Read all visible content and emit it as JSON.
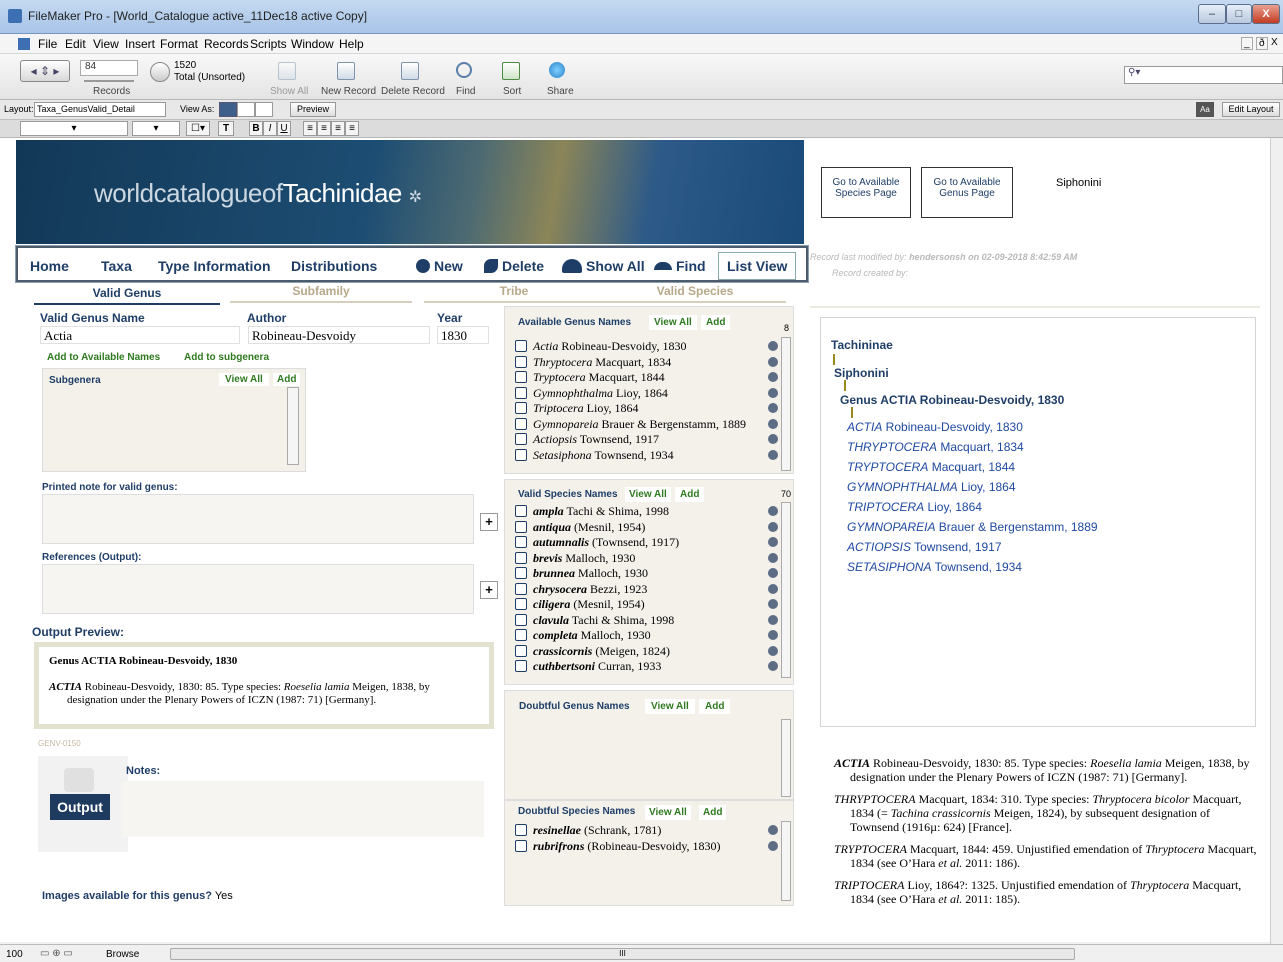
{
  "window": {
    "title": "FileMaker Pro - [World_Catalogue active_11Dec18 active Copy]",
    "controls": [
      "–",
      "□",
      "X"
    ]
  },
  "menubar": {
    "items": [
      "File",
      "Edit",
      "View",
      "Insert",
      "Format",
      "Records",
      "Scripts",
      "Window",
      "Help"
    ],
    "right_controls": [
      "_",
      "ð",
      "X"
    ]
  },
  "toolbar": {
    "record_number": "84",
    "records_label": "Records",
    "total": "1520",
    "total_label": "Total (Unsorted)",
    "buttons": [
      "Show All",
      "New Record",
      "Delete Record",
      "Find",
      "Sort",
      "Share"
    ]
  },
  "layoutbar": {
    "layout_label": "Layout:",
    "layout_value": "Taxa_GenusValid_Detail",
    "viewas_label": "View As:",
    "preview": "Preview",
    "edit_layout": "Edit Layout",
    "aa": "Aa"
  },
  "banner": {
    "logo_light": "worldcatalogueof",
    "logo_bold": "Tachinidae"
  },
  "nav": {
    "items": [
      "Home",
      "Taxa",
      "Type Information",
      "Distributions"
    ],
    "new": "New",
    "delete": "Delete",
    "show_all": "Show All",
    "find": "Find",
    "list_view": "List View"
  },
  "right_header": {
    "go_species": "Go to Available Species Page",
    "go_genus": "Go to Available Genus Page",
    "tribe": "Siphonini",
    "modified_label": "Record last modified by:",
    "modified_value": "hendersonsh on 02-09-2018 8:42:59 AM",
    "created_label": "Record created by:"
  },
  "tabs": [
    "Valid Genus",
    "Subfamily",
    "Tribe",
    "Valid Species"
  ],
  "genus": {
    "name_label": "Valid Genus Name",
    "name": "Actia",
    "author_label": "Author",
    "author": "Robineau-Desvoidy",
    "year_label": "Year",
    "year": "1830",
    "add_available": "Add to Available Names",
    "add_subgenera": "Add to subgenera",
    "subgenera_label": "Subgenera",
    "view_all": "View All",
    "add": "Add",
    "printed_note_label": "Printed note for valid genus:",
    "references_label": "References (Output):",
    "output_preview_label": "Output Preview:",
    "preview_title": "Genus ACTIA Robineau-Desvoidy, 1830",
    "preview_genus": "ACTIA",
    "preview_body": "Robineau-Desvoidy, 1830: 85. Type species:",
    "preview_species": "Roeselia lamia",
    "preview_rest": "Meigen, 1838, by designation under the Plenary Powers of ICZN (1987: 71) [Germany].",
    "record_id": "GENV-0150",
    "notes_label": "Notes:",
    "output_btn": "Output",
    "images_label": "Images available for this genus?",
    "images_value": "Yes"
  },
  "available_genus": {
    "label": "Available Genus Names",
    "count": "8",
    "rows": [
      {
        "name": "Actia",
        "rest": "Robineau-Desvoidy, 1830"
      },
      {
        "name": "Thryptocera",
        "rest": "Macquart, 1834"
      },
      {
        "name": "Tryptocera",
        "rest": "Macquart, 1844"
      },
      {
        "name": "Gymnophthalma",
        "rest": "Lioy, 1864"
      },
      {
        "name": "Triptocera",
        "rest": "Lioy, 1864"
      },
      {
        "name": "Gymnopareia",
        "rest": "Brauer & Bergenstamm, 1889"
      },
      {
        "name": "Actiopsis",
        "rest": "Townsend, 1917"
      },
      {
        "name": "Setasiphona",
        "rest": "Townsend, 1934"
      }
    ]
  },
  "valid_species": {
    "label": "Valid Species Names",
    "count": "70",
    "rows": [
      {
        "name": "ampla",
        "rest": "Tachi & Shima, 1998"
      },
      {
        "name": "antiqua",
        "rest": "(Mesnil, 1954)"
      },
      {
        "name": "autumnalis",
        "rest": "(Townsend, 1917)"
      },
      {
        "name": "brevis",
        "rest": "Malloch, 1930"
      },
      {
        "name": "brunnea",
        "rest": "Malloch, 1930"
      },
      {
        "name": "chrysocera",
        "rest": "Bezzi, 1923"
      },
      {
        "name": "ciligera",
        "rest": "(Mesnil, 1954)"
      },
      {
        "name": "clavula",
        "rest": "Tachi & Shima, 1998"
      },
      {
        "name": "completa",
        "rest": "Malloch, 1930"
      },
      {
        "name": "crassicornis",
        "rest": "(Meigen, 1824)"
      },
      {
        "name": "cuthbertsoni",
        "rest": "Curran, 1933"
      }
    ]
  },
  "doubtful_genus": {
    "label": "Doubtful Genus Names"
  },
  "doubtful_species": {
    "label": "Doubtful Species Names",
    "rows": [
      {
        "name": "resinellae",
        "rest": "(Schrank, 1781)"
      },
      {
        "name": "rubrifrons",
        "rest": "(Robineau-Desvoidy, 1830)"
      }
    ]
  },
  "tree": {
    "subfamily": "Tachininae",
    "tribe": "Siphonini",
    "genus": "Genus ACTIA Robineau-Desvoidy, 1830",
    "names": [
      {
        "name": "ACTIA",
        "rest": "Robineau-Desvoidy, 1830"
      },
      {
        "name": "THRYPTOCERA",
        "rest": "Macquart, 1834"
      },
      {
        "name": "TRYPTOCERA",
        "rest": "Macquart, 1844"
      },
      {
        "name": "GYMNOPHTHALMA",
        "rest": "Lioy, 1864"
      },
      {
        "name": "TRIPTOCERA",
        "rest": "Lioy, 1864"
      },
      {
        "name": "GYMNOPAREIA",
        "rest": "Brauer & Bergenstamm, 1889"
      },
      {
        "name": "ACTIOPSIS",
        "rest": "Townsend, 1917"
      },
      {
        "name": "SETASIPHONA",
        "rest": "Townsend, 1934"
      }
    ]
  },
  "output_text": {
    "p1_genus": "ACTIA",
    "p1_a": "Robineau-Desvoidy, 1830: 85. Type species:",
    "p1_species": "Roeselia lamia",
    "p1_b": "Meigen, 1838, by designation under the Plenary Powers of ICZN (1987: 71) [Germany].",
    "p2_genus": "THRYPTOCERA",
    "p2_a": "Macquart, 1834: 310. Type species:",
    "p2_species": "Thryptocera bicolor",
    "p2_b": "Macquart, 1834 (=",
    "p2_syn": "Tachina crassicornis",
    "p2_c": "Meigen, 1824), by subsequent designation of Townsend (1916µ: 624)  [France].",
    "p3_genus": "TRYPTOCERA",
    "p3_a": "Macquart, 1844: 459. Unjustified emendation of",
    "p3_ref": "Thryptocera",
    "p3_b": "Macquart, 1834 (see O’Hara",
    "p3_etal": "et al.",
    "p3_c": "2011: 186).",
    "p4_genus": "TRIPTOCERA",
    "p4_a": "Lioy, 1864?: 1325. Unjustified emendation of",
    "p4_ref": "Thryptocera",
    "p4_b": "Macquart, 1834 (see O’Hara",
    "p4_etal": "et al.",
    "p4_c": "2011: 185)."
  },
  "statusbar": {
    "zoom": "100",
    "mode": "Browse",
    "scroll": "III"
  }
}
